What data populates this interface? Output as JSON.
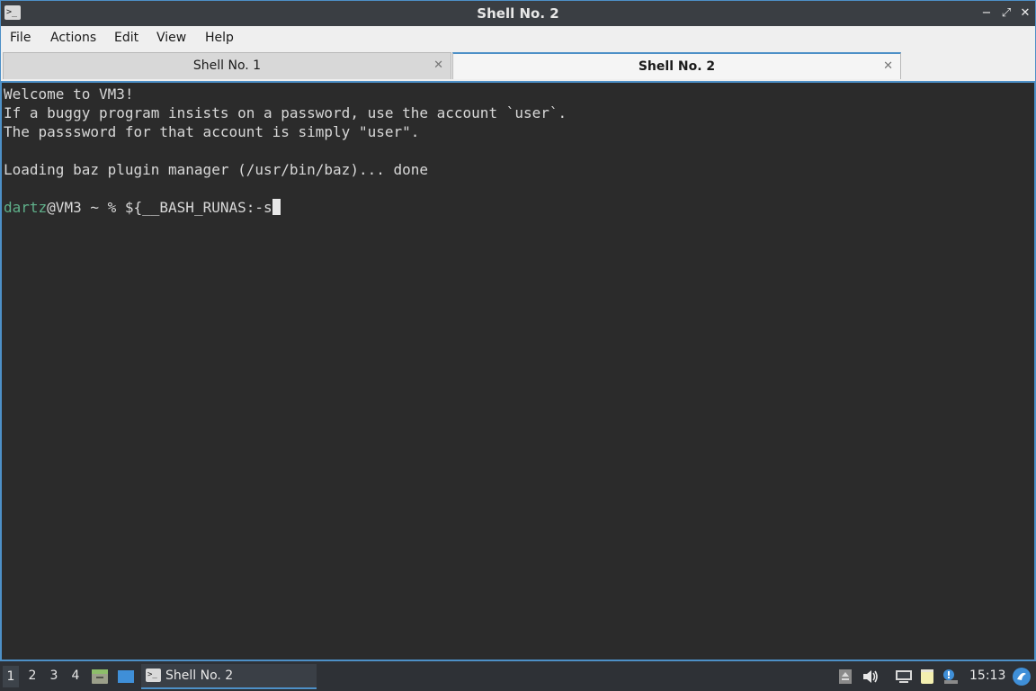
{
  "window": {
    "title": "Shell No. 2",
    "icon": "terminal-icon",
    "app_icon_glyph": ">_",
    "controls": {
      "minimize": "−",
      "maximize": "⤢",
      "close": "✕"
    }
  },
  "menu": [
    "File",
    "Actions",
    "Edit",
    "View",
    "Help"
  ],
  "tabs": [
    {
      "label": "Shell No. 1",
      "active": false,
      "close": "✕"
    },
    {
      "label": "Shell No. 2",
      "active": true,
      "close": "✕"
    }
  ],
  "terminal": {
    "lines": [
      "Welcome to VM3!",
      "If a buggy program insists on a password, use the account `user`.",
      "The passsword for that account is simply \"user\".",
      "",
      "Loading baz plugin manager (/usr/bin/baz)... done",
      ""
    ],
    "prompt": {
      "user": "dartz",
      "host_part": "@VM3 ~ % ",
      "command": "${__BASH_RUNAS:-s"
    }
  },
  "taskbar": {
    "workspaces": [
      "1",
      "2",
      "3",
      "4"
    ],
    "active_workspace": "1",
    "task_label": "Shell No. 2",
    "task_icon_glyph": ">_",
    "clock": "15:13",
    "tray_icons": [
      "clipboard-icon",
      "volume-icon",
      "network-icon",
      "notes-icon",
      "update-notifier-icon",
      "distro-logo-icon"
    ],
    "colors": {
      "accent": "#4d90c7",
      "prompt_user": "#5fb08a"
    }
  }
}
